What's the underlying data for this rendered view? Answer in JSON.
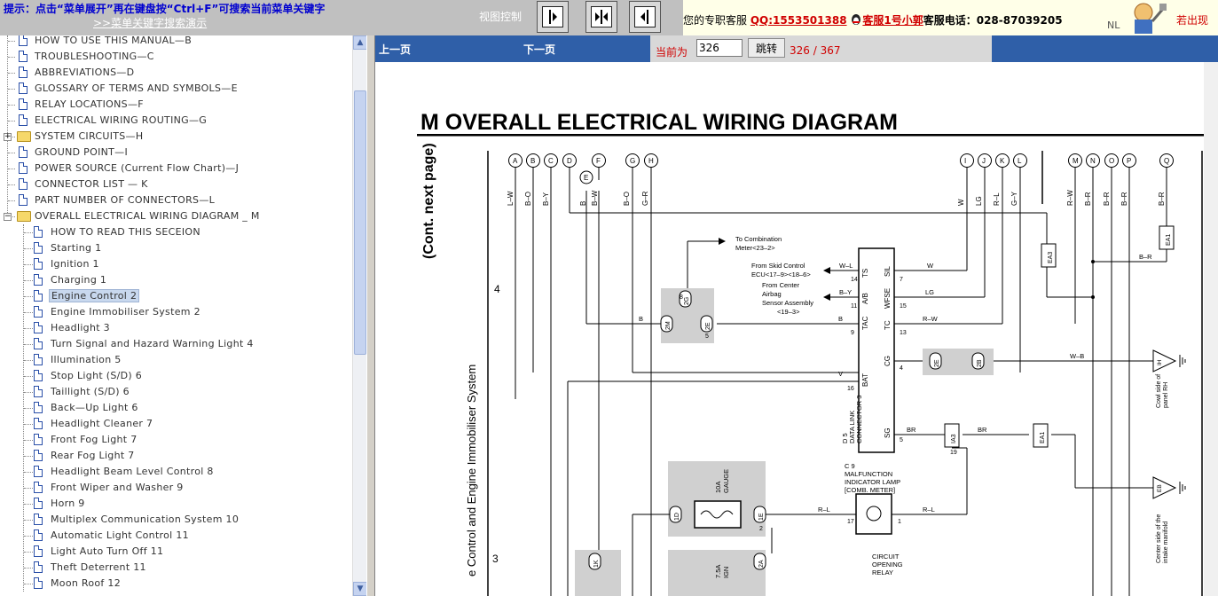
{
  "topbar": {
    "hint": "提示：点击“菜单展开”再在键盘按“Ctrl+F”可搜索当前菜单关键字",
    "demo_link": ">>菜单关键字搜索演示",
    "view_control": "视图控制",
    "contact_prefix": "您的专职客服",
    "qq": "QQ:1553501388",
    "service": "客服1号小郭",
    "phone": "客服电话：028-87039205",
    "nl": "NL",
    "exit": "若出现"
  },
  "tree": {
    "top_items": [
      "HOW TO USE THIS MANUAL—B",
      "TROUBLESHOOTING—C",
      "ABBREVIATIONS—D",
      "GLOSSARY OF TERMS AND SYMBOLS—E",
      "RELAY LOCATIONS—F",
      "ELECTRICAL WIRING ROUTING—G",
      "SYSTEM CIRCUITS—H",
      "GROUND POINT—I",
      "POWER SOURCE (Current Flow Chart)—J",
      "CONNECTOR LIST — K",
      "PART NUMBER OF CONNECTORS—L",
      "OVERALL ELECTRICAL WIRING DIAGRAM _ M"
    ],
    "children": [
      "HOW TO READ THIS SECEION",
      "Starting 1",
      "Ignition 1",
      "Charging 1",
      "Engine Control 2",
      "Engine Immobiliser System 2",
      "Headlight 3",
      "Turn Signal and Hazard Warning Light 4",
      "Illumination 5",
      "Stop Light (S/D) 6",
      "Taillight (S/D) 6",
      "Back—Up Light 6",
      "Headlight Cleaner 7",
      "Front Fog Light 7",
      "Rear Fog Light 7",
      "Headlight Beam Level Control 8",
      "Front Wiper and Washer 9",
      "Horn 9",
      "Multiplex Communication System 10",
      "Automatic Light Control 11",
      "Light Auto Turn Off 11",
      "Theft Deterrent 11",
      "Moon Roof 12"
    ],
    "selected": "Engine Control 2"
  },
  "nav": {
    "prev": "上一页",
    "next": "下一页",
    "current_label": "当前为",
    "page_value": "326",
    "jump": "跳转",
    "page_count": "326 / 367"
  },
  "diagram": {
    "title": "M  OVERALL ELECTRICAL WIRING DIAGRAM",
    "cont_label": "(Cont.  next page)",
    "section_label": "e Control and Engine Immobiliser System",
    "row_4": "4",
    "row_3": "3",
    "top_connectors": [
      "A",
      "B",
      "C",
      "D",
      "F",
      "G",
      "H",
      "I",
      "J",
      "K",
      "L",
      "M",
      "N",
      "O",
      "P",
      "Q"
    ],
    "e_connector": "E",
    "wire_colors_top": [
      "L–W",
      "B–O",
      "B–Y",
      "B",
      "B–W",
      "B–O",
      "G–R",
      "W",
      "LG",
      "R–L",
      "G–Y",
      "R–W",
      "B–R",
      "B–R",
      "B–R",
      "B–R"
    ],
    "to_combination": "To Combination",
    "meter_ref": "Meter<23–2>",
    "from_skid": "From Skid Control",
    "ecu_ref": "ECU<17–9><18–6>",
    "from_center": "From Center",
    "airbag": "Airbag",
    "sensor_assembly": "Sensor Assembly",
    "sensor_ref": "<19–3>",
    "dlc_label": "D 5\nDATA LINK\nCONNECTOR 3",
    "pins": [
      "TS",
      "A/B",
      "TAC",
      "BAT",
      "WFSE",
      "TC",
      "CG",
      "SG",
      "SIL"
    ],
    "mil_label": "C 9\nMALFUNCTION\nINDICATOR LAMP\n[COMB. METER]",
    "gauge": "10A\nGAUGE",
    "ign": "7.5A\nIGN",
    "circuit_relay": "CIRCUIT\nOPENING\nRELAY",
    "cowl": "Cowl side of\npanel RH",
    "intake": "Center side of the\nintake manifold",
    "ground_ih": "IH",
    "ground_eb": "EB",
    "ea1": "EA1",
    "ea3": "EA3",
    "ia3": "IA3",
    "wires": {
      "w": "W",
      "lg": "LG",
      "rw": "R–W",
      "wb": "W–B",
      "br": "BR",
      "rl": "R–L",
      "b": "B",
      "v": "V",
      "bo": "B–O",
      "lr": "L–R",
      "br2": "B–R",
      "wl": "W–L",
      "by": "B–Y"
    },
    "conn_2g": "2G",
    "conn_2m": "2M",
    "conn_2e_a": "2E",
    "conn_2e_b": "2E",
    "conn_2b": "2B",
    "conn_1d": "1D",
    "conn_1e": "1E",
    "conn_1k": "1K",
    "conn_2a": "2A",
    "pin_nums": {
      "p8": "8",
      "p5": "5",
      "p9": "9",
      "p16": "16",
      "p14": "14",
      "p11": "11",
      "p7": "7",
      "p15": "15",
      "p13": "13",
      "p4": "4",
      "p5b": "5",
      "p1": "1",
      "p17": "17",
      "p19": "19",
      "p4b": "4",
      "p1b": "1",
      "p2": "2"
    }
  }
}
